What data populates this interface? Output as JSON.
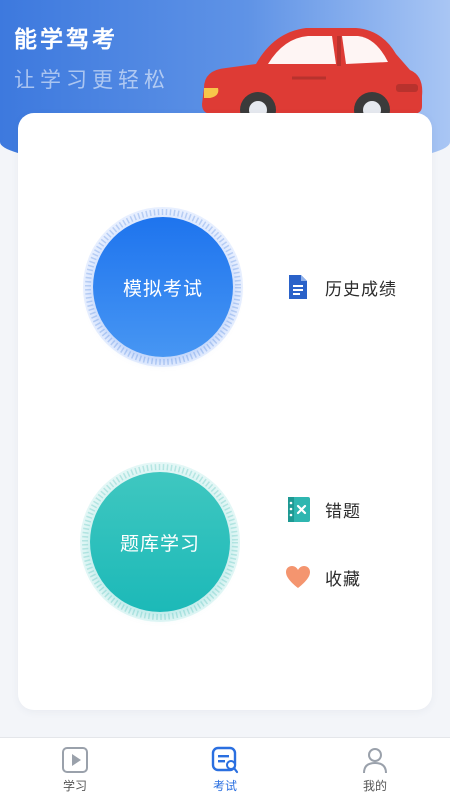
{
  "header": {
    "title": "能学驾考",
    "slogan": "让学习更轻松",
    "illustration": "red-car-illustration"
  },
  "main": {
    "exam_button": {
      "label": "模拟考试",
      "color": "#2a7cf0"
    },
    "bank_button": {
      "label": "题库学习",
      "color": "#2ec0bd"
    },
    "history": {
      "label": "历史成绩",
      "icon": "document-icon"
    },
    "mistakes": {
      "label": "错题",
      "icon": "notebook-x-icon"
    },
    "favorites": {
      "label": "收藏",
      "icon": "heart-icon"
    }
  },
  "tabbar": {
    "items": [
      {
        "label": "学习",
        "icon": "play-icon",
        "active": false
      },
      {
        "label": "考试",
        "icon": "exam-icon",
        "active": true
      },
      {
        "label": "我的",
        "icon": "user-icon",
        "active": false
      }
    ],
    "active_color": "#2a6fe0"
  }
}
